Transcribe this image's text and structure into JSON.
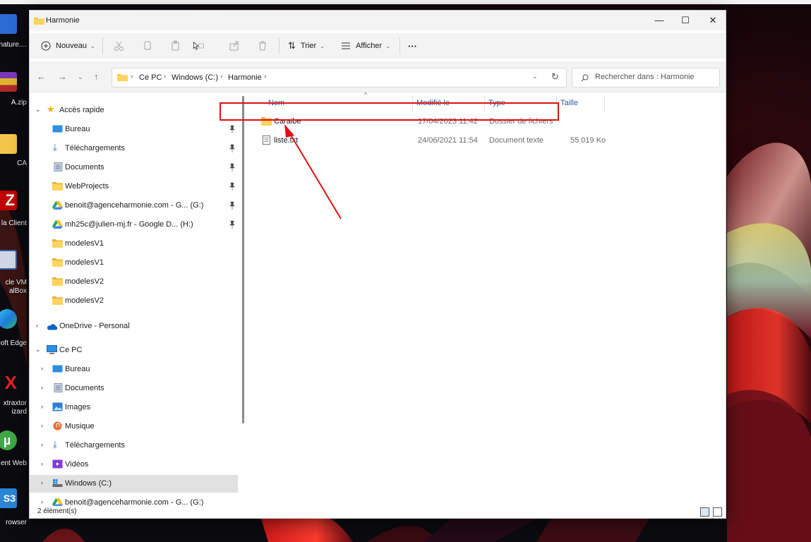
{
  "window": {
    "title": "Harmonie",
    "minimize": "—",
    "maximize": "☐",
    "close": "✕"
  },
  "toolbar": {
    "new_label": "Nouveau",
    "sort_label": "Trier",
    "view_label": "Afficher",
    "more_label": "···"
  },
  "address": {
    "crumbs": [
      "Ce PC",
      "Windows (C:)",
      "Harmonie"
    ],
    "search_placeholder": "Rechercher dans : Harmonie"
  },
  "navpane": {
    "quick_access": "Accès rapide",
    "quick_items": [
      {
        "label": "Bureau"
      },
      {
        "label": "Téléchargements"
      },
      {
        "label": "Documents"
      },
      {
        "label": "WebProjects"
      },
      {
        "label": "benoit@agenceharmonie.com - G... (G:)"
      },
      {
        "label": "mh25c@julien-mj.fr - Google D... (H:)"
      },
      {
        "label": "modelesV1"
      },
      {
        "label": "modelesV1"
      },
      {
        "label": "modelesV2"
      },
      {
        "label": "modelesV2"
      }
    ],
    "onedrive": "OneDrive - Personal",
    "this_pc": "Ce PC",
    "pc_items": [
      {
        "label": "Bureau"
      },
      {
        "label": "Documents"
      },
      {
        "label": "Images"
      },
      {
        "label": "Musique"
      },
      {
        "label": "Téléchargements"
      },
      {
        "label": "Vidéos"
      },
      {
        "label": "Windows (C:)"
      },
      {
        "label": "benoit@agenceharmonie.com - G... (G:)"
      }
    ]
  },
  "filelist": {
    "columns": [
      "Nom",
      "Modifié le",
      "Type",
      "Taille"
    ],
    "rows": [
      {
        "name": "Caraibe",
        "modified": "17/04/2023 11:42",
        "type": "Dossier de fichiers",
        "size": ""
      },
      {
        "name": "liste.txt",
        "modified": "24/06/2021 11:54",
        "type": "Document texte",
        "size": "55 019 Ko"
      }
    ]
  },
  "status": {
    "count": "2 élément(s)"
  },
  "desktop": {
    "icons": [
      "nature....",
      "A.zip",
      "CA",
      "la Client",
      "cle VM\nalBox",
      "oft Edge",
      "xtraxtor\nizard",
      "ent Web",
      "rowser"
    ]
  },
  "colors": {
    "accent": "#0067c0",
    "highlight": "#e01010",
    "folder": "#f4c64a"
  }
}
